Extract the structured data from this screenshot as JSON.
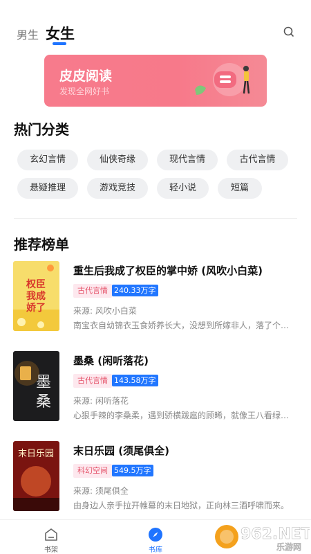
{
  "header": {
    "tabs": [
      {
        "label": "男生",
        "active": false
      },
      {
        "label": "女生",
        "active": true
      }
    ],
    "search_icon": "search-icon"
  },
  "banner": {
    "title": "皮皮阅读",
    "subtitle": "发现全网好书"
  },
  "categories": {
    "title": "热门分类",
    "items": [
      "玄幻言情",
      "仙侠奇缘",
      "现代言情",
      "古代言情",
      "悬疑推理",
      "游戏竞技",
      "轻小说",
      "短篇"
    ]
  },
  "ranking": {
    "title": "推荐榜单",
    "books": [
      {
        "title": "重生后我成了权臣的掌中娇 (风吹小白菜)",
        "category": "古代言情",
        "words": "240.33万字",
        "author": "来源: 风吹小白菜",
        "desc": "南宝衣自幼锦衣玉食娇养长大，没想到所嫁非人，落了个凄凉下场",
        "cover_text": [
          "权臣",
          "我成",
          "娇了"
        ]
      },
      {
        "title": "墨桑 (闲听落花)",
        "category": "古代言情",
        "words": "143.58万字",
        "author": "来源: 闲听落花",
        "desc": "心狠手辣的李桑柔，遇到骄横跋扈的顾晞，就像王八看绿豆对上了眼",
        "cover_text": [
          "墨",
          "桑"
        ]
      },
      {
        "title": "末日乐园 (须尾俱全)",
        "category": "科幻空间",
        "words": "549.5万字",
        "author": "来源: 须尾俱全",
        "desc": "由身边人亲手拉开帷幕的末日地狱，正向林三酒呼啸而来。",
        "cover_text": [
          "末日乐园"
        ]
      }
    ]
  },
  "bottom_nav": {
    "items": [
      {
        "label": "书架",
        "icon": "bookshelf-icon",
        "active": false
      },
      {
        "label": "书库",
        "icon": "compass-icon",
        "active": true
      }
    ]
  },
  "watermark": {
    "text": "962.NET",
    "sub": "乐游网"
  },
  "colors": {
    "accent": "#1f74ff",
    "banner": "#f77b8c",
    "chip_bg": "#eff0f2",
    "tag_cat_bg": "#fde8ee",
    "tag_cat_fg": "#e5546a"
  }
}
